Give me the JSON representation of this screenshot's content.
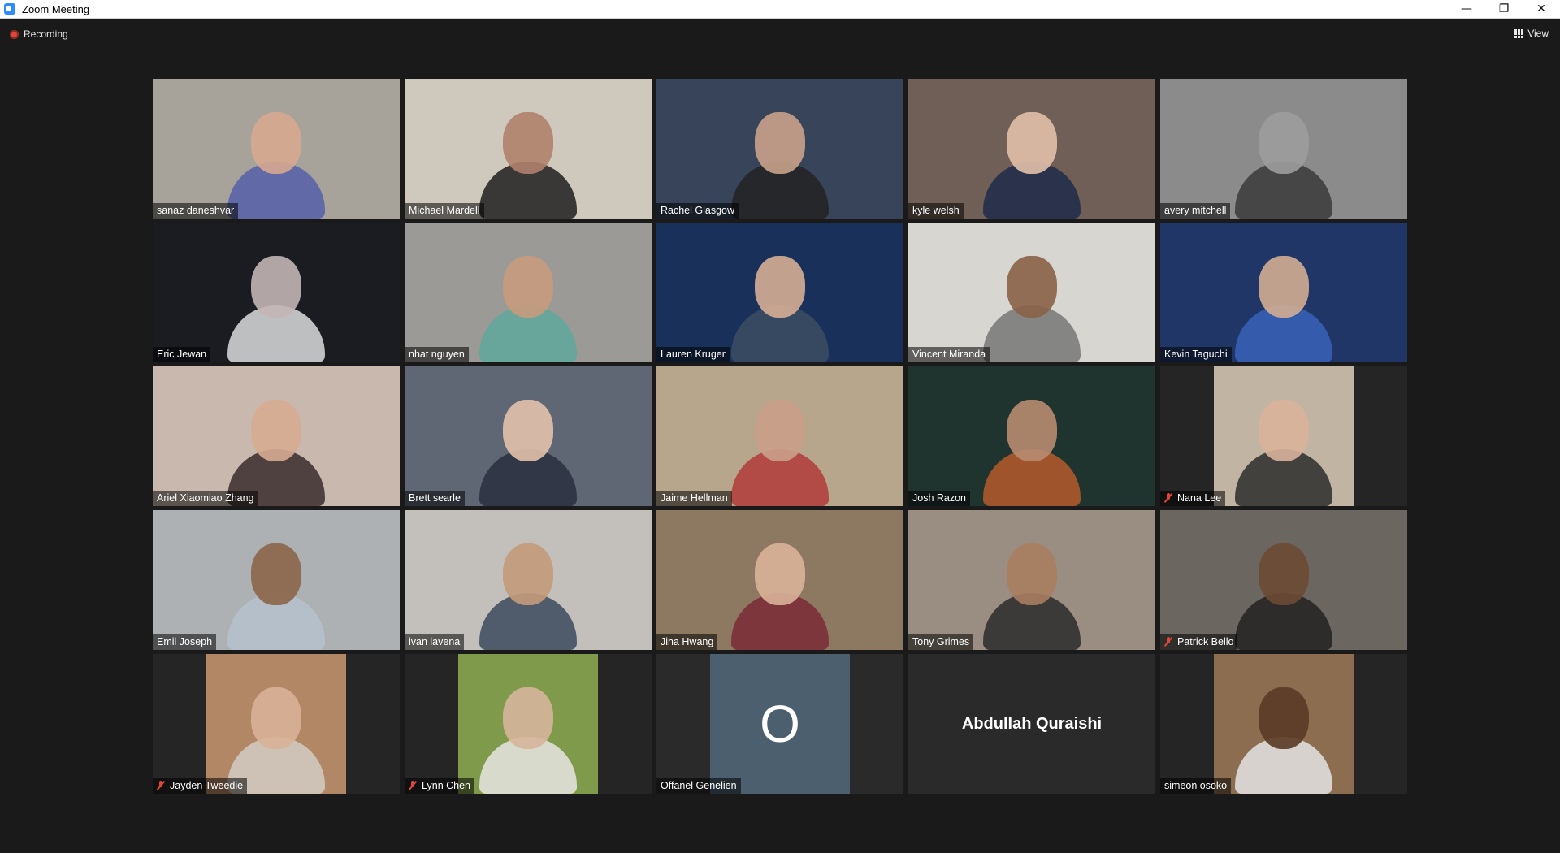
{
  "window": {
    "title": "Zoom Meeting",
    "controls": {
      "minimize": "—",
      "restore": "❐",
      "close": "✕"
    }
  },
  "toolbar": {
    "recording_label": "Recording",
    "view_label": "View"
  },
  "colors": {
    "active_speaker_border": "#c8e35a",
    "muted_icon": "#e0453a",
    "avatar_bg": "#4b5f6e"
  },
  "participants": [
    {
      "name": "sanaz daneshvar",
      "muted": false,
      "bg": "#a7a29a",
      "shirt": "#5560a8",
      "skin": "#d7a990"
    },
    {
      "name": "Michael Mardell",
      "muted": false,
      "bg": "#cfc8bd",
      "shirt": "#1e1e1e",
      "skin": "#b0826b"
    },
    {
      "name": "Rachel Glasgow",
      "muted": false,
      "bg": "#37445a",
      "shirt": "#222222",
      "skin": "#c9a28a"
    },
    {
      "name": "kyle welsh",
      "muted": false,
      "bg": "#6f5f56",
      "shirt": "#1f2a4a",
      "skin": "#e1c0aa"
    },
    {
      "name": "avery mitchell",
      "muted": false,
      "bg": "#8b8b8b",
      "shirt": "#3a3a3a",
      "skin": "#9c9c9c"
    },
    {
      "name": "Eric Jewan",
      "muted": false,
      "bg": "#1a1c22",
      "shirt": "#dcdcdc",
      "skin": "#c3b5b5"
    },
    {
      "name": "nhat nguyen",
      "muted": false,
      "bg": "#9c9a97",
      "shirt": "#5fa79a",
      "skin": "#c69b7d"
    },
    {
      "name": "Lauren Kruger",
      "muted": false,
      "bg": "#19305a",
      "shirt": "#3d4d63",
      "skin": "#d6ae95"
    },
    {
      "name": "Vincent Miranda",
      "muted": false,
      "bg": "#d8d6d1",
      "shirt": "#777777",
      "skin": "#8b6248"
    },
    {
      "name": "Kevin Taguchi",
      "muted": false,
      "bg": "#1f3666",
      "shirt": "#3a63b8",
      "skin": "#d1ad91"
    },
    {
      "name": "Ariel Xiaomiao Zhang",
      "muted": false,
      "bg": "#c8b8ae",
      "shirt": "#3a2c2c",
      "skin": "#d6ac92"
    },
    {
      "name": "Brett searle",
      "muted": false,
      "bg": "#5f6775",
      "shirt": "#2a2f40",
      "skin": "#e2c1ac"
    },
    {
      "name": "Jaime Hellman",
      "muted": false,
      "bg": "#b8a68c",
      "shirt": "#b03a3a",
      "skin": "#caa089"
    },
    {
      "name": "Josh Razon",
      "muted": false,
      "bg": "#1f332f",
      "shirt": "#b65a2b",
      "skin": "#b78c70"
    },
    {
      "name": "Nana Lee",
      "muted": true,
      "bg": "#c1b4a2",
      "shirt": "#2d2d2d",
      "skin": "#d9b39b",
      "pad": true
    },
    {
      "name": "Emil Joseph",
      "muted": false,
      "bg": "#aeb1b3",
      "shirt": "#b5c2cc",
      "skin": "#8c6549"
    },
    {
      "name": "ivan lavena",
      "muted": false,
      "bg": "#c3c0bb",
      "shirt": "#3c4a5e",
      "skin": "#c39a7b"
    },
    {
      "name": "Jina Hwang",
      "muted": false,
      "bg": "#8d7862",
      "shirt": "#7a2a36",
      "skin": "#d9b29a"
    },
    {
      "name": "Tony Grimes",
      "muted": false,
      "bg": "#9a8e82",
      "shirt": "#2c2c2c",
      "skin": "#a97d5f",
      "active": true
    },
    {
      "name": "Patrick Bello",
      "muted": true,
      "bg": "#6b6660",
      "shirt": "#222222",
      "skin": "#6d4a34"
    },
    {
      "name": "Jayden Tweedie",
      "muted": true,
      "bg": "#b28765",
      "shirt": "#d2cdc4",
      "skin": "#d8b197",
      "pad": true
    },
    {
      "name": "Lynn Chen",
      "muted": true,
      "bg": "#7f9a4a",
      "shirt": "#e8e6e2",
      "skin": "#d7b59c",
      "pad": true
    },
    {
      "name": "Offanel Genelien",
      "muted": false,
      "avatar_letter": "O"
    },
    {
      "name": "Abdullah Quraishi",
      "muted": false,
      "name_only": true
    },
    {
      "name": "simeon osoko",
      "muted": false,
      "bg": "#8c6d4f",
      "shirt": "#e4e4e4",
      "skin": "#5a3a25",
      "pad": true
    }
  ]
}
